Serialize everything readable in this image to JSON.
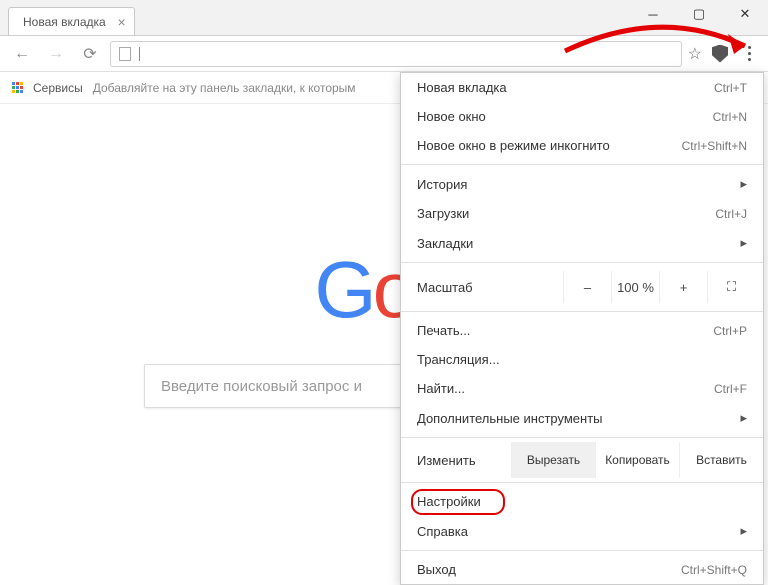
{
  "tab": {
    "title": "Новая вкладка"
  },
  "bookmarks": {
    "services": "Сервисы",
    "hint": "Добавляйте на эту панель закладки, к которым"
  },
  "search": {
    "placeholder": "Введите поисковый запрос и"
  },
  "menu": {
    "new_tab": {
      "label": "Новая вкладка",
      "short": "Ctrl+T"
    },
    "new_window": {
      "label": "Новое окно",
      "short": "Ctrl+N"
    },
    "incognito": {
      "label": "Новое окно в режиме инкогнито",
      "short": "Ctrl+Shift+N"
    },
    "history": {
      "label": "История"
    },
    "downloads": {
      "label": "Загрузки",
      "short": "Ctrl+J"
    },
    "bookmarks": {
      "label": "Закладки"
    },
    "zoom": {
      "label": "Масштаб",
      "minus": "–",
      "value": "100 %",
      "plus": "+"
    },
    "print": {
      "label": "Печать...",
      "short": "Ctrl+P"
    },
    "cast": {
      "label": "Трансляция..."
    },
    "find": {
      "label": "Найти...",
      "short": "Ctrl+F"
    },
    "more_tools": {
      "label": "Дополнительные инструменты"
    },
    "edit": {
      "label": "Изменить",
      "cut": "Вырезать",
      "copy": "Копировать",
      "paste": "Вставить"
    },
    "settings": {
      "label": "Настройки"
    },
    "help": {
      "label": "Справка"
    },
    "exit": {
      "label": "Выход",
      "short": "Ctrl+Shift+Q"
    }
  }
}
